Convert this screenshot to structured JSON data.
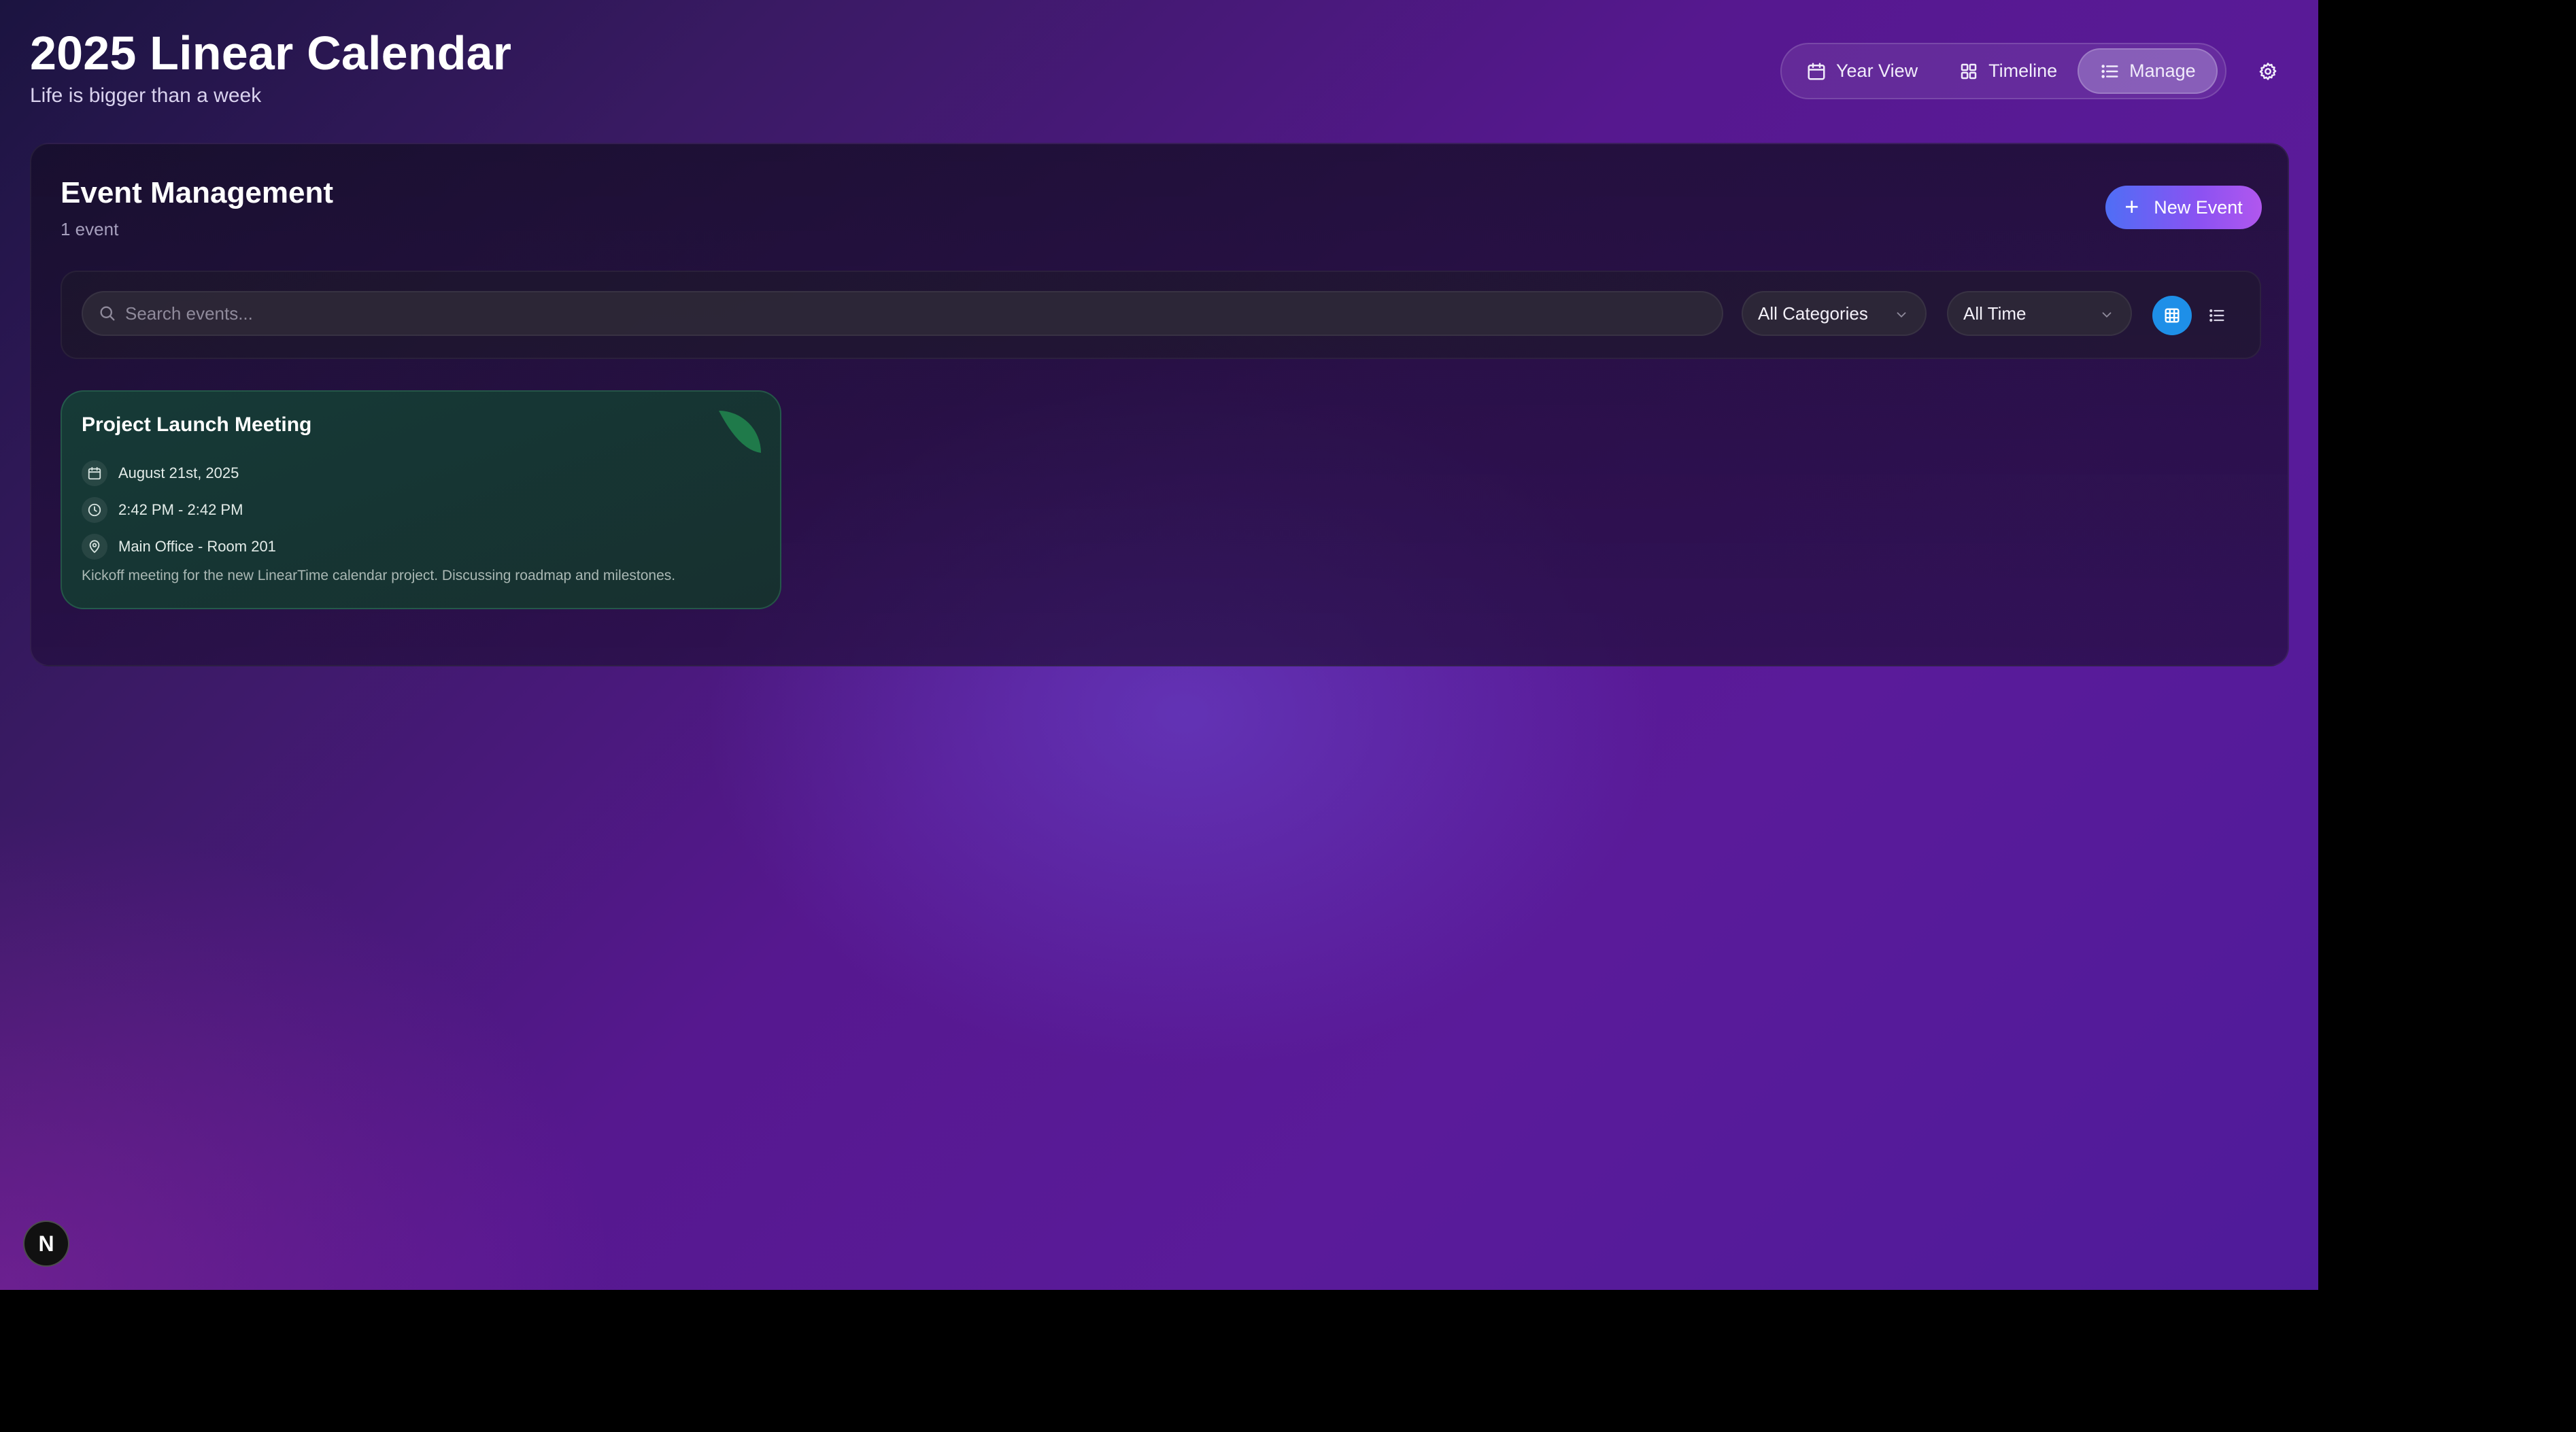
{
  "header": {
    "title": "2025 Linear Calendar",
    "subtitle": "Life is bigger than a week"
  },
  "views": [
    {
      "label": "Year View",
      "icon": "calendar-icon",
      "active": false
    },
    {
      "label": "Timeline",
      "icon": "grid-icon",
      "active": false
    },
    {
      "label": "Manage",
      "icon": "list-icon",
      "active": true
    }
  ],
  "settings": {
    "icon": "gear-icon"
  },
  "panel": {
    "title": "Event Management",
    "count": "1 event",
    "new_event_label": "New Event"
  },
  "filters": {
    "search_placeholder": "Search events...",
    "category": "All Categories",
    "time": "All Time",
    "view_mode": "grid"
  },
  "events": [
    {
      "title": "Project Launch Meeting",
      "date": "August 21st, 2025",
      "time": "2:42 PM - 2:42 PM",
      "location": "Main Office - Room 201",
      "description": "Kickoff meeting for the new LinearTime calendar project. Discussing roadmap and milestones.",
      "color": "#1f7a4a"
    }
  ],
  "badge": {
    "label": "N"
  },
  "colors": {
    "accent_blue": "#1e8fe8",
    "new_event_gradient_start": "#4f6ef5",
    "new_event_gradient_end": "#b157ee",
    "card_bg": "#163a37"
  }
}
